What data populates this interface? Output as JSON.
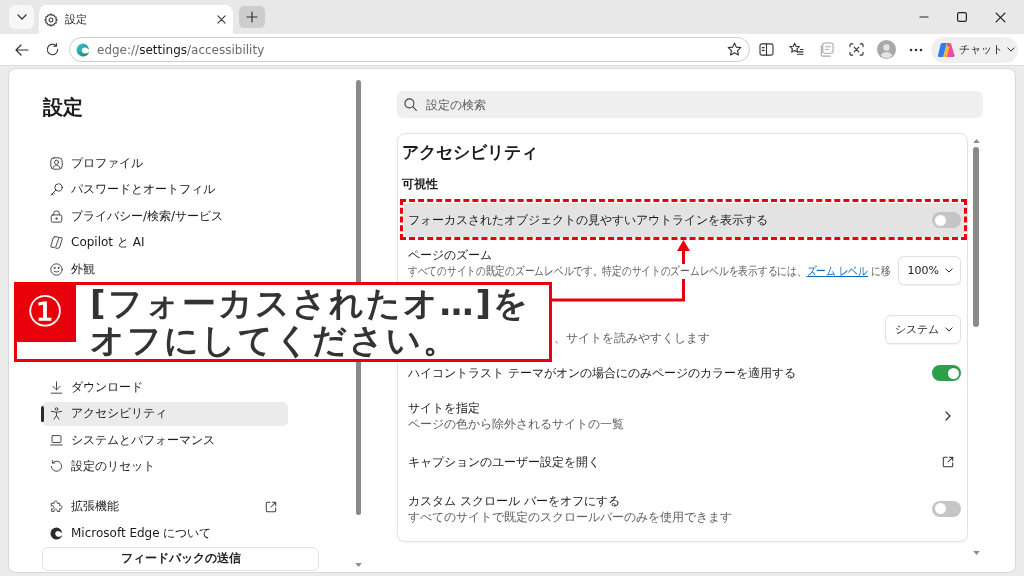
{
  "tabs": [
    {
      "title": "設定",
      "selected": true
    }
  ],
  "address_bar": {
    "url": "edge://**settings**/accessibility"
  },
  "toolbar": {
    "chat_label": "チャット"
  },
  "sidebar": {
    "title": "設定",
    "groups": [
      {
        "items": [
          {
            "label": "プロファイル",
            "selected": false,
            "external": false
          },
          {
            "label": "パスワードとオートフィル",
            "selected": false,
            "external": false
          },
          {
            "label": "プライバシー/検索/サービス",
            "selected": false,
            "external": false
          },
          {
            "label": "Copilot と AI",
            "selected": false,
            "external": false
          },
          {
            "label": "外観",
            "selected": false,
            "external": false
          }
        ]
      },
      {
        "items": [
          {
            "label": "ダウンロード",
            "selected": false,
            "external": false
          },
          {
            "label": "アクセシビリティ",
            "selected": true,
            "external": false
          },
          {
            "label": "システムとパフォーマンス",
            "selected": false,
            "external": false
          },
          {
            "label": "設定のリセット",
            "selected": false,
            "external": false
          }
        ]
      },
      {
        "items": [
          {
            "label": "拡張機能",
            "selected": false,
            "external": true
          },
          {
            "label": "Microsoft Edge について",
            "selected": false,
            "external": false
          }
        ]
      }
    ],
    "feedback_button": "フィードバックの送信"
  },
  "search": {
    "placeholder": "設定の検索"
  },
  "section": {
    "title": "アクセシビリティ",
    "subtitle": "可視性",
    "rows": [
      {
        "kind": "toggle",
        "title": "フォーカスされたオブジェクトの見やすいアウトラインを表示する",
        "on": false,
        "highlighted": true,
        "marked": true
      },
      {
        "kind": "select",
        "title": "ページのズーム",
        "description": "すべてのサイトの既定のズームレベルです。特定のサイトのズームレベルを表示するには、",
        "link": "ズーム レベル",
        "description_end": " に移",
        "value": "100%",
        "highlighted": false,
        "marked": false
      },
      {
        "kind": "select",
        "description": "、サイトを読みやすくします",
        "value": "システム",
        "highlighted": false,
        "marked": false
      },
      {
        "kind": "toggle",
        "title": "ハイコントラスト テーマがオンの場合にのみページのカラーを適用する",
        "on": true,
        "highlighted": false,
        "marked": false
      },
      {
        "kind": "link",
        "title": "サイトを指定",
        "description": "ページの色から除外されるサイトの一覧",
        "highlighted": false,
        "marked": false
      },
      {
        "kind": "external",
        "title": "キャプションのユーザー設定を開く",
        "highlighted": false,
        "marked": false
      },
      {
        "kind": "toggle",
        "title": "カスタム スクロール バーをオフにする",
        "description": "すべてのサイトで既定のスクロールバーのみを使用できます",
        "on": false,
        "highlighted": false,
        "marked": false
      }
    ]
  },
  "annotation": {
    "number": "①",
    "lines": [
      "[フォーカスされたオ…]を",
      "オフにしてください。"
    ]
  }
}
